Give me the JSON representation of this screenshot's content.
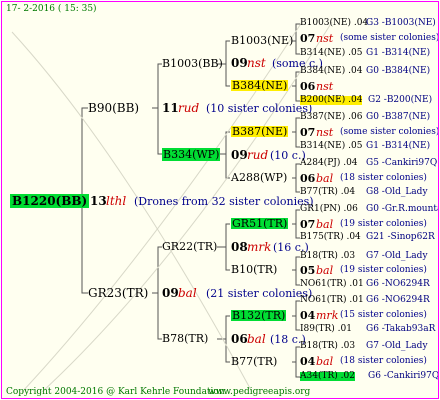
{
  "header": {
    "date": "17-  2-2016 ( 15: 35)"
  },
  "root": {
    "id": "B1220(BB)",
    "gen": "13",
    "name": "lthl",
    "note": "(Drones from 32 sister colonies)"
  },
  "g1": [
    {
      "id": "B90(BB)"
    },
    {
      "id": "GR23(TR)"
    }
  ],
  "g2": [
    {
      "id": "B1003(BB)",
      "gen": "11",
      "name": "rud",
      "note": "(10 sister colonies)"
    },
    {
      "id": "B334(WP)",
      "gen": "09",
      "name": "rud",
      "note": "(10 c.)"
    },
    {
      "id": "GR22(TR)",
      "gen": "09",
      "name": "bal",
      "note": "(21 sister colonies)"
    },
    {
      "id": "B78(TR)",
      "gen": "06",
      "name": "bal",
      "note": "(18 c.)"
    }
  ],
  "g3": [
    {
      "id": "B1003(NE)",
      "gen": "09",
      "name": "nst",
      "note": "(some c.)"
    },
    {
      "id": "B384(NE)"
    },
    {
      "id": "B387(NE)",
      "gen": "09",
      "name": "rud",
      "note": "(10 c.)"
    },
    {
      "id": "A288(WP)"
    },
    {
      "id": "GR51(TR)",
      "gen": "08",
      "name": "mrk",
      "note": "(16 c.)"
    },
    {
      "id": "B10(TR)"
    },
    {
      "id": "B132(TR)",
      "gen": "06",
      "name": "bal",
      "note": "(18 c.)"
    },
    {
      "id": "B77(TR)"
    }
  ],
  "g4": [
    {
      "id": "B1003(NE) .04",
      "ref": "G3 -B1003(NE)"
    },
    {
      "gen": "07",
      "name": "nst",
      "note": "(some sister colonies)"
    },
    {
      "id": "B314(NE) .05",
      "ref": "G1 -B314(NE)"
    },
    {
      "id": "B384(NE) .04",
      "ref": "G0 -B384(NE)"
    },
    {
      "gen": "06",
      "name": "nst",
      "note": ""
    },
    {
      "id": "B200(NE) .04",
      "ref": "G2 -B200(NE)"
    },
    {
      "id": "B387(NE) .06",
      "ref": "G0 -B387(NE)"
    },
    {
      "gen": "07",
      "name": "nst",
      "note": "(some sister colonies)"
    },
    {
      "id": "B314(NE) .05",
      "ref": "G1 -B314(NE)"
    },
    {
      "id": "A284(PJ) .04",
      "ref": "G5 -Cankiri97Q"
    },
    {
      "gen": "06",
      "name": "bal",
      "note": "(18 sister colonies)"
    },
    {
      "id": "B77(TR) .04",
      "ref": "G8 -Old_Lady"
    },
    {
      "id": "GR1(PN) .06",
      "ref": "G0 -Gr.R.mounta"
    },
    {
      "gen": "07",
      "name": "bal",
      "note": "(19 sister colonies)"
    },
    {
      "id": "B175(TR) .04",
      "ref": "G21 -Sinop62R"
    },
    {
      "id": "B18(TR) .03",
      "ref": "G7 -Old_Lady"
    },
    {
      "gen": "05",
      "name": "bal",
      "note": "(19 sister colonies)"
    },
    {
      "id": "NO61(TR) .01",
      "ref": "G6 -NO6294R"
    },
    {
      "id": "NO61(TR) .01",
      "ref": "G6 -NO6294R"
    },
    {
      "gen": "04",
      "name": "mrk",
      "note": "(15 sister colonies)"
    },
    {
      "id": "I89(TR) .01",
      "ref": "G6 -Takab93aR"
    },
    {
      "id": "B18(TR) .03",
      "ref": "G7 -Old_Lady"
    },
    {
      "gen": "04",
      "name": "bal",
      "note": "(18 sister colonies)"
    },
    {
      "id": "A34(TR) .02",
      "ref": "G6 -Cankiri97Q"
    }
  ],
  "footer": {
    "copyright": "Copyright 2004-2016 @ Karl Kehrle Foundation.",
    "site": "www.pedigreeapis.org"
  },
  "colors": {
    "green": "#00dd33",
    "yellow": "#ffee00",
    "border": "#ff00ff"
  }
}
